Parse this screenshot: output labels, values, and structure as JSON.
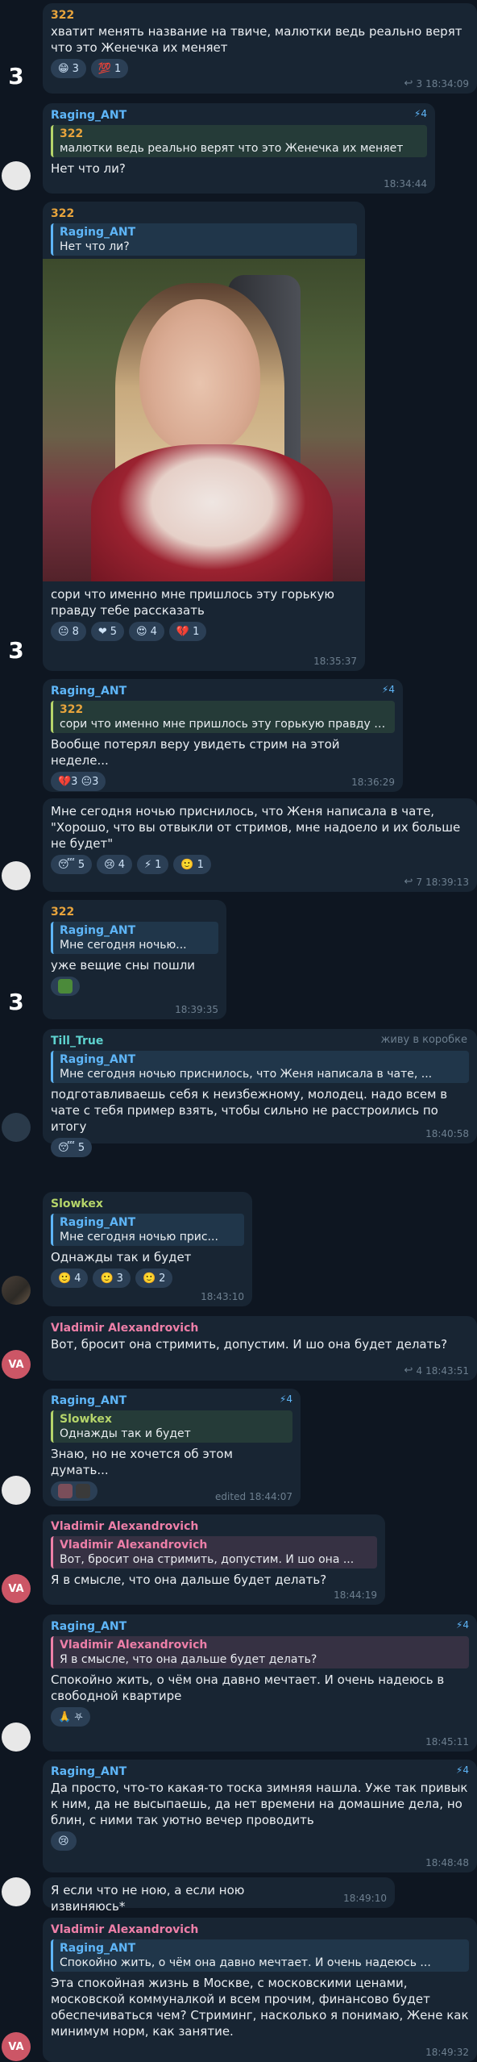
{
  "messages": [
    {
      "sender": "322",
      "text": "хватит менять название на твиче, малютки ведь реально верят что это Женечка их меняет",
      "reactions": [
        {
          "emoji": "😁",
          "count": "3"
        },
        {
          "emoji": "💯",
          "count": "1"
        }
      ],
      "replies": "3",
      "time": "18:34:09"
    },
    {
      "sender": "Raging_ANT",
      "boost": "4",
      "quote_name": "322",
      "quote_text": "малютки ведь реально верят что это Женечка их меняет",
      "text": "Нет что ли?",
      "time": "18:34:44"
    },
    {
      "sender": "322",
      "quote_name": "Raging_ANT",
      "quote_text": "Нет что ли?",
      "text": "сори что именно мне пришлось эту горькую правду тебе рассказать",
      "reactions": [
        {
          "emoji": "😐",
          "count": "8"
        },
        {
          "emoji": "❤",
          "count": "5"
        },
        {
          "emoji": "😍",
          "count": "4"
        },
        {
          "emoji": "💔",
          "count": "1"
        }
      ],
      "time": "18:35:37"
    },
    {
      "sender": "Raging_ANT",
      "boost": "4",
      "quote_name": "322",
      "quote_text": "сори что именно мне пришлось эту горькую правду тебе рассказать",
      "text": "Вообще потерял веру увидеть стрим на этой неделе...",
      "reactions_text": "💔3 😐3",
      "time": "18:36:29"
    },
    {
      "text": "Мне сегодня ночью приснилось, что Женя написала в чате, \"Хорошо, что вы отвыкли от стримов, мне надоело и их больше не будет\"",
      "reactions": [
        {
          "emoji": "😴",
          "count": "5"
        },
        {
          "emoji": "😢",
          "count": "4"
        },
        {
          "emoji": "⚡",
          "count": "1"
        },
        {
          "emoji": "🙂",
          "count": "1"
        }
      ],
      "replies": "7",
      "time": "18:39:13"
    },
    {
      "sender": "322",
      "quote_name": "Raging_ANT",
      "quote_text": "Мне сегодня ночью...",
      "text": "уже вещие сны пошли",
      "time": "18:39:35"
    },
    {
      "sender": "Till_True",
      "tag": "живу в коробке",
      "quote_name": "Raging_ANT",
      "quote_text": "Мне сегодня ночью приснилось, что Женя написала в чате, ...",
      "text": "подготавливаешь себя к неизбежному, молодец. надо всем в чате с тебя пример взять, чтобы сильно не расстроились по итогу",
      "reactions": [
        {
          "emoji": "😴",
          "count": "5"
        }
      ],
      "time": "18:40:58"
    },
    {
      "sender": "Slowkex",
      "quote_name": "Raging_ANT",
      "quote_text": "Мне сегодня ночью прис...",
      "text": "Однажды так и будет",
      "reactions": [
        {
          "emoji": "🙂",
          "count": "4"
        },
        {
          "emoji": "🙂",
          "count": "3"
        },
        {
          "emoji": "🙂",
          "count": "2"
        }
      ],
      "time": "18:43:10"
    },
    {
      "sender": "Vladimir Alexandrovich",
      "avatar": "VA",
      "text": "Вот, бросит она стримить, допустим. И шо она будет делать?",
      "replies": "4",
      "time": "18:43:51"
    },
    {
      "sender": "Raging_ANT",
      "boost": "4",
      "quote_name": "Slowkex",
      "quote_text": "Однажды так и будет",
      "text": "Знаю, но не хочется об этом думать...",
      "edited": "edited",
      "time": "18:44:07"
    },
    {
      "sender": "Vladimir Alexandrovich",
      "avatar": "VA",
      "quote_name": "Vladimir Alexandrovich",
      "quote_text": "Вот, бросит она стримить, допустим. И шо она ...",
      "text": "Я в смысле, что она дальше будет делать?",
      "time": "18:44:19"
    },
    {
      "sender": "Raging_ANT",
      "boost": "4",
      "quote_name": "Vladimir Alexandrovich",
      "quote_text": "Я в смысле, что она дальше будет делать?",
      "text": "Спокойно жить, о чём она давно мечтает. И очень надеюсь в свободной квартире",
      "reactions_text": "🙏 ⛧",
      "time": "18:45:11"
    },
    {
      "sender": "Raging_ANT",
      "boost": "4",
      "text": "Да просто, что-то какая-то тоска зимняя нашла. Уже так привык к ним, да не высыпаешь, да нет времени на домашние дела, но блин, с ними так уютно вечер проводить",
      "reactions_text": "😢",
      "time": "18:48:48"
    },
    {
      "text": "Я если что не ною, а если ною извиняюсь*",
      "time": "18:49:10"
    },
    {
      "sender": "Vladimir Alexandrovich",
      "avatar": "VA",
      "quote_name": "Raging_ANT",
      "quote_text": "Спокойно жить, о чём она давно мечтает. И очень надеюсь ...",
      "text": "Эта спокойная жизнь в Москве, с московскими ценами, московской коммуналкой и всем прочим, финансово будет обеспечиваться чем? Стриминг, насколько я понимаю, Жене как минимум норм, как занятие.",
      "time": "18:49:32"
    }
  ],
  "colors": {
    "background": "#0e1621",
    "bubble": "#182533",
    "name_322": "#e8a43c",
    "name_raging": "#5eb5f7",
    "name_vladimir": "#ee7fa8",
    "name_slowkex": "#b5d56a",
    "name_till": "#5ed3cf"
  }
}
